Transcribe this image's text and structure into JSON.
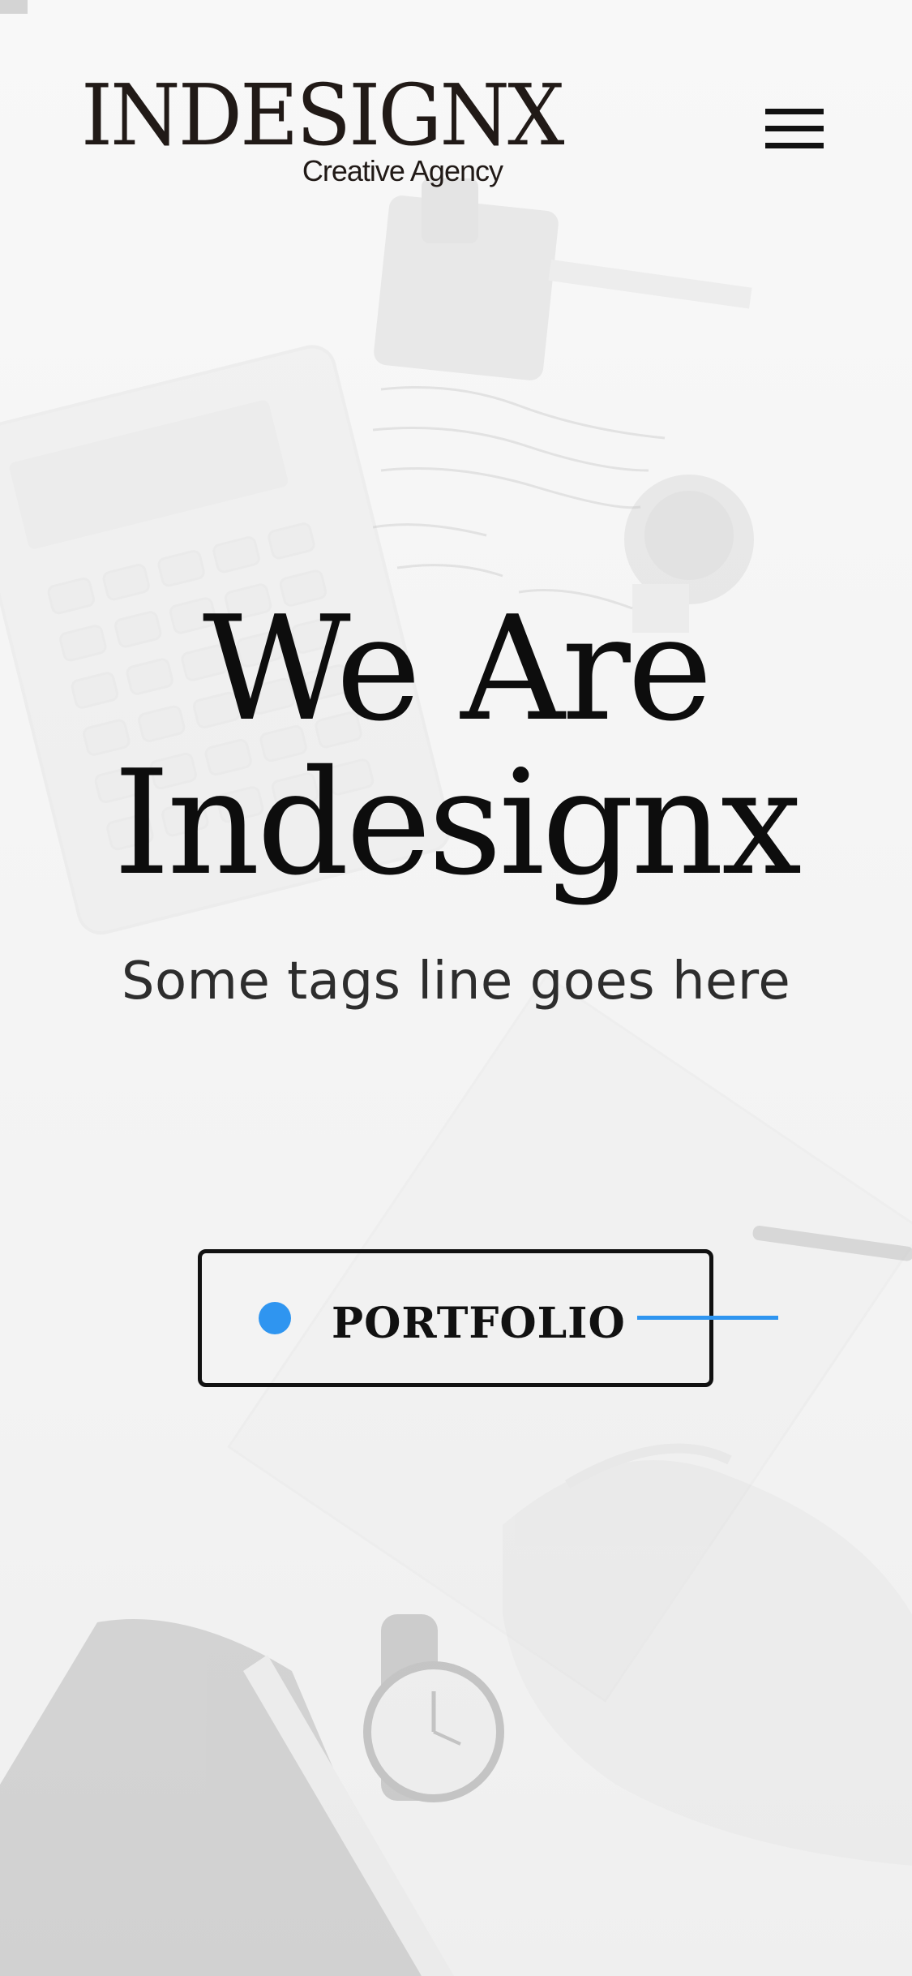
{
  "header": {
    "logo_text": "INDESIGNX",
    "logo_subtitle": "Creative Agency",
    "menu_icon": "hamburger-menu-icon"
  },
  "hero": {
    "title_line1": "We Are",
    "title_line2": "Indesignx",
    "tagline": "Some tags line goes here"
  },
  "cta": {
    "label": "PORTFOLIO",
    "accent_color": "#2f95f0"
  },
  "colors": {
    "text": "#0d0d0d",
    "background": "#f7f7f7",
    "accent": "#2f95f0"
  }
}
